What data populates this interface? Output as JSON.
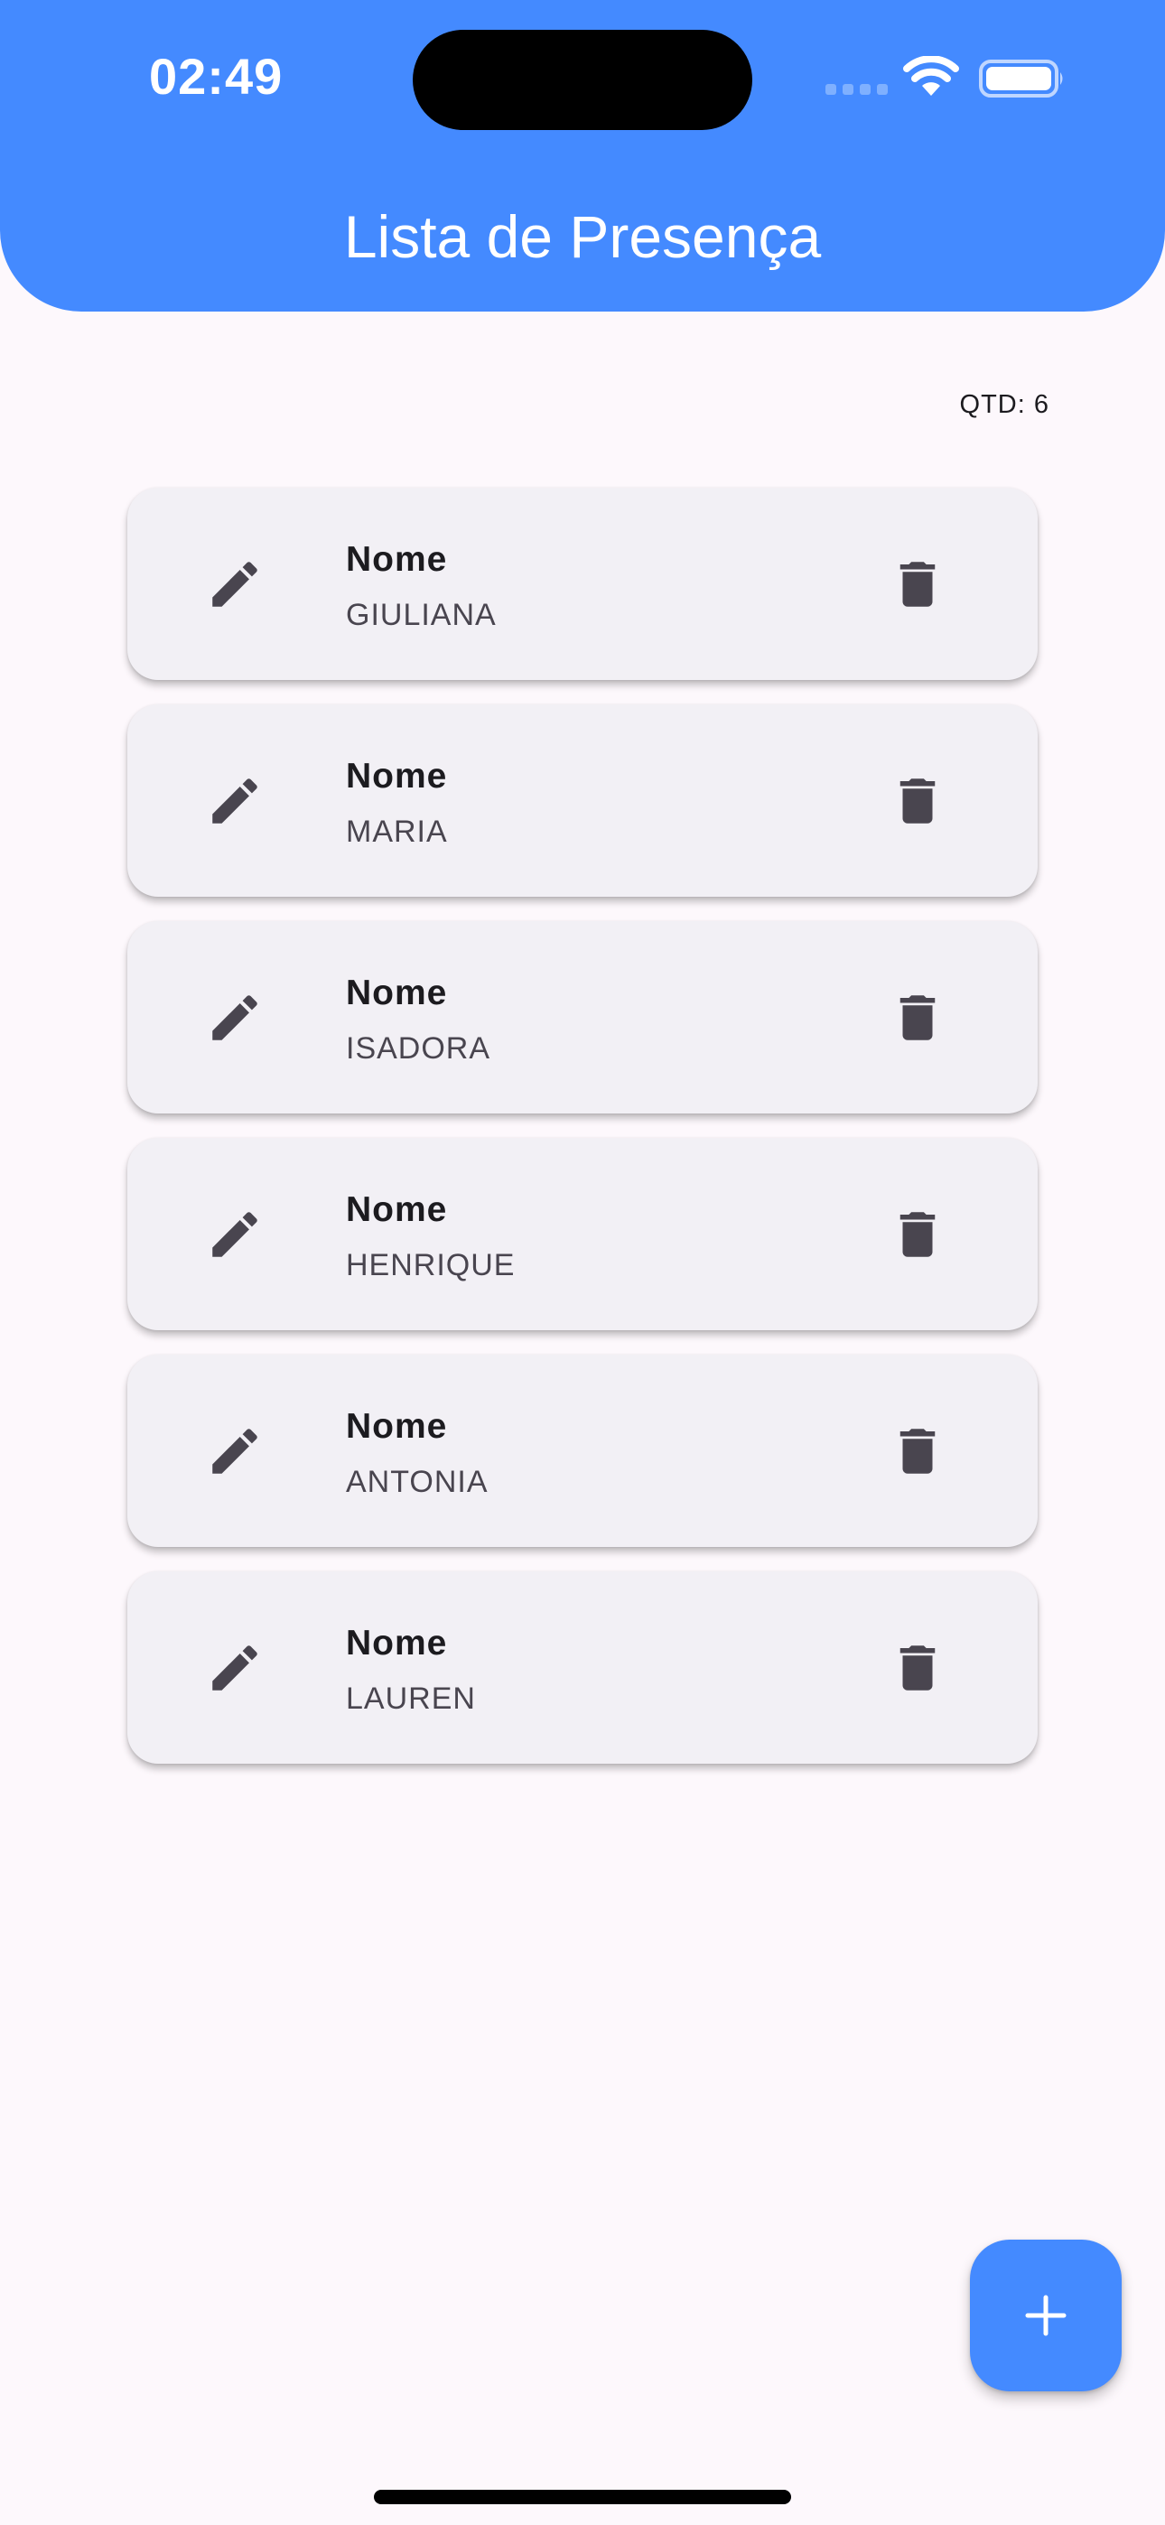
{
  "status_bar": {
    "time": "02:49",
    "icons": [
      "cellular-signal-icon",
      "wifi-icon",
      "battery-icon"
    ]
  },
  "appbar": {
    "title": "Lista de Presença"
  },
  "counter": {
    "text": "QTD: 6"
  },
  "items": [
    {
      "label": "Nome",
      "value": "GIULIANA"
    },
    {
      "label": "Nome",
      "value": "MARIA"
    },
    {
      "label": "Nome",
      "value": "ISADORA"
    },
    {
      "label": "Nome",
      "value": "HENRIQUE"
    },
    {
      "label": "Nome",
      "value": "ANTONIA"
    },
    {
      "label": "Nome",
      "value": "LAUREN"
    }
  ],
  "item_icons": {
    "edit": "pencil-icon",
    "delete": "trash-icon"
  },
  "fab": {
    "icon": "plus-icon"
  },
  "colors": {
    "primary": "#448AFF",
    "background": "#FDF8FC",
    "card": "#F2F0F5",
    "icon": "#49454F"
  }
}
